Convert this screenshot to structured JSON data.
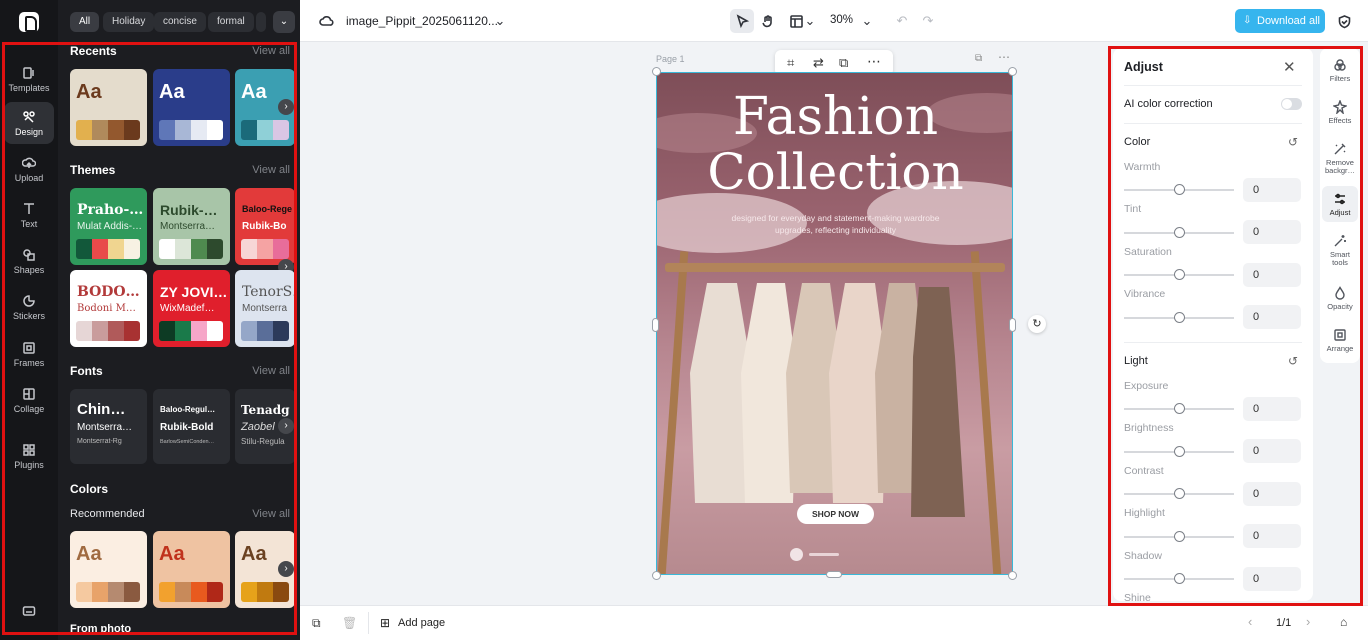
{
  "rail": {
    "items": [
      {
        "label": "Templates",
        "icon": "templates-icon"
      },
      {
        "label": "Design",
        "icon": "design-icon"
      },
      {
        "label": "Upload",
        "icon": "upload-icon"
      },
      {
        "label": "Text",
        "icon": "text-icon"
      },
      {
        "label": "Shapes",
        "icon": "shapes-icon"
      },
      {
        "label": "Stickers",
        "icon": "stickers-icon"
      },
      {
        "label": "Frames",
        "icon": "frames-icon"
      },
      {
        "label": "Collage",
        "icon": "collage-icon"
      },
      {
        "label": "Plugins",
        "icon": "plugins-icon"
      }
    ]
  },
  "panel": {
    "chips": [
      "All",
      "Holiday",
      "concise",
      "formal"
    ],
    "recents": {
      "title": "Recents",
      "view_all": "View all",
      "aa": [
        "Aa",
        "Aa",
        "Aa"
      ]
    },
    "themes": {
      "title": "Themes",
      "view_all": "View all",
      "cards": [
        {
          "t1": "Praho-…",
          "t2": "Mulat Addis-…"
        },
        {
          "t1": "Rubik-…",
          "t2": "Montserra…"
        },
        {
          "t1": "Baloo-Rege",
          "t2": "Rubik-Bo"
        },
        {
          "t1": "BODO…",
          "t2": "Bodoni M…"
        },
        {
          "t1": "ZY JOVI…",
          "t2": "WixMadef…"
        },
        {
          "t1": "TenorS…",
          "t2": "Montserra"
        }
      ]
    },
    "fonts": {
      "title": "Fonts",
      "view_all": "View all",
      "cards": [
        {
          "t1": "Chin…",
          "t2": "Montserra…",
          "t3": "Montserrat-Rg"
        },
        {
          "t1": "Baloo-Regul…",
          "t2": "Rubik-Bold",
          "t3": "BarlowSemiConden…"
        },
        {
          "t1": "Tenadg",
          "t2": "Zaobel",
          "t3": "Stilu-Regula"
        }
      ]
    },
    "colors": {
      "title": "Colors",
      "recommended": "Recommended",
      "view_all": "View all",
      "aa": [
        "Aa",
        "Aa",
        "Aa"
      ]
    },
    "from_photo": "From photo"
  },
  "topbar": {
    "filename": "image_Pippit_2025061120...",
    "zoom": "30%",
    "download": "Download all"
  },
  "canvas": {
    "page_label": "Page 1",
    "poster": {
      "line1": "Fashion",
      "line2": "Collection",
      "subtitle": "designed for everyday and statement-making wardrobe upgrades, reflecting individuality",
      "button": "SHOP NOW"
    }
  },
  "bottombar": {
    "add_page": "Add page",
    "page_count": "1/1"
  },
  "adjust": {
    "title": "Adjust",
    "ai_color": "AI color correction",
    "color_section": "Color",
    "light_section": "Light",
    "color_rows": [
      {
        "label": "Warmth",
        "value": "0"
      },
      {
        "label": "Tint",
        "value": "0"
      },
      {
        "label": "Saturation",
        "value": "0"
      },
      {
        "label": "Vibrance",
        "value": "0"
      }
    ],
    "light_rows": [
      {
        "label": "Exposure",
        "value": "0"
      },
      {
        "label": "Brightness",
        "value": "0"
      },
      {
        "label": "Contrast",
        "value": "0"
      },
      {
        "label": "Highlight",
        "value": "0"
      },
      {
        "label": "Shadow",
        "value": "0"
      },
      {
        "label": "Shine",
        "value": ""
      }
    ]
  },
  "tools": [
    {
      "label": "Filters"
    },
    {
      "label": "Effects"
    },
    {
      "label": "Remove backgr…"
    },
    {
      "label": "Adjust"
    },
    {
      "label": "Smart tools"
    },
    {
      "label": "Opacity"
    },
    {
      "label": "Arrange"
    }
  ]
}
